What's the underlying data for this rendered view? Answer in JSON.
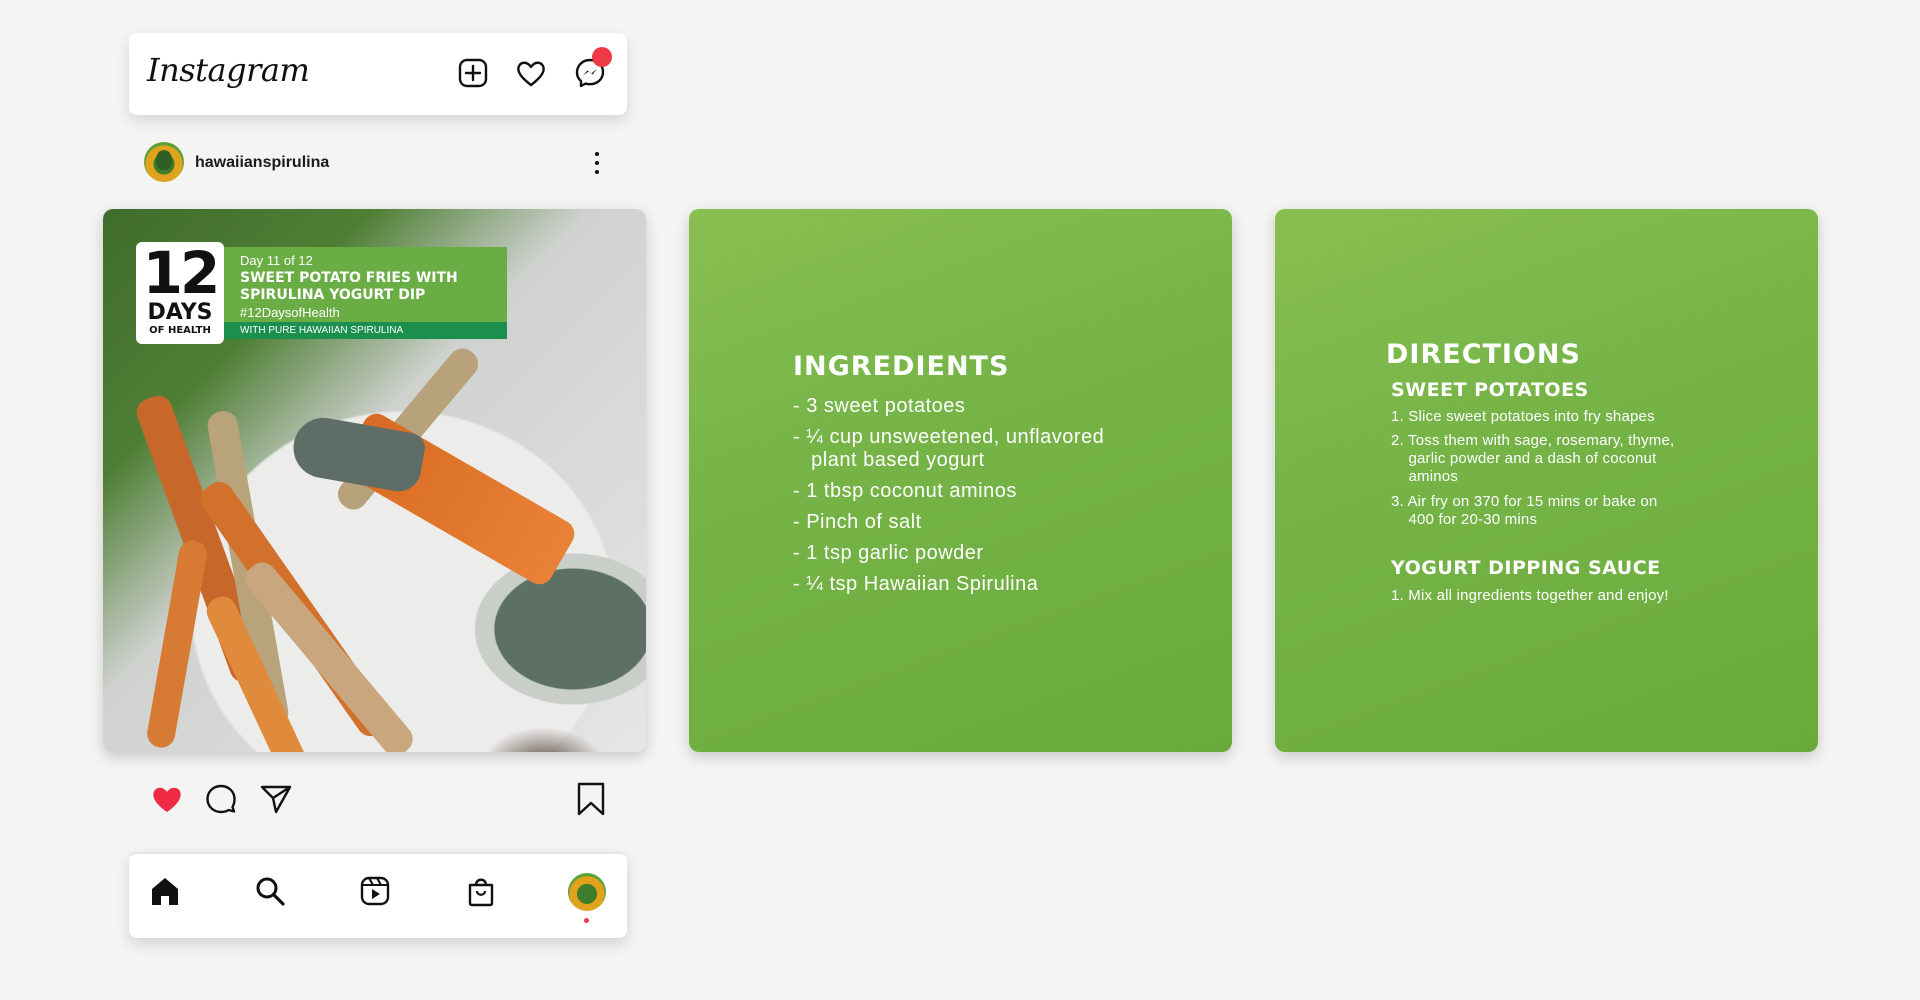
{
  "topbar": {
    "logo": "Instagram",
    "icons": [
      "add-post-icon",
      "heart-icon",
      "messenger-icon"
    ],
    "notification_color": "#ee3a46"
  },
  "profile": {
    "username": "hawaiianspirulina"
  },
  "post_overlay": {
    "badge_number": "12",
    "badge_days": "DAYS",
    "badge_of_health": "OF HEALTH",
    "day_label": "Day 11 of 12",
    "title": "SWEET POTATO FRIES WITH\nSPIRULINA YOGURT DIP",
    "hashtag": "#12DaysofHealth",
    "with_line": "WITH PURE HAWAIIAN SPIRULINA"
  },
  "ingredients": {
    "heading": "INGREDIENTS",
    "items": [
      "- 3 sweet potatoes",
      "- ¼ cup unsweetened, unflavored\n   plant based yogurt",
      "- 1 tbsp coconut aminos",
      "- Pinch of salt",
      "- 1 tsp garlic powder",
      "- ¼ tsp Hawaiian Spirulina"
    ]
  },
  "directions": {
    "heading": "DIRECTIONS",
    "sweet_potatoes_heading": "SWEET POTATOES",
    "steps": [
      "1. Slice sweet potatoes into fry shapes",
      "2. Toss them with sage, rosemary, thyme,\n    garlic powder and a dash of coconut\n    aminos",
      "3. Air fry on 370 for 15 mins or bake on\n    400 for 20-30 mins"
    ],
    "sauce_heading": "YOGURT DIPPING SAUCE",
    "sauce_steps": [
      "1. Mix all ingredients together and enjoy!"
    ]
  },
  "actions": {
    "liked": true,
    "like_color": "#ee2a45",
    "icons": [
      "heart-filled-icon",
      "comment-icon",
      "share-icon",
      "bookmark-icon"
    ]
  },
  "bottom_nav": {
    "icons": [
      "home-icon",
      "search-icon",
      "reels-icon",
      "shop-icon",
      "profile-avatar"
    ]
  },
  "colors": {
    "card_green": "#76b448",
    "title_green": "#6bad45",
    "strip_green": "#1a8f4e"
  }
}
